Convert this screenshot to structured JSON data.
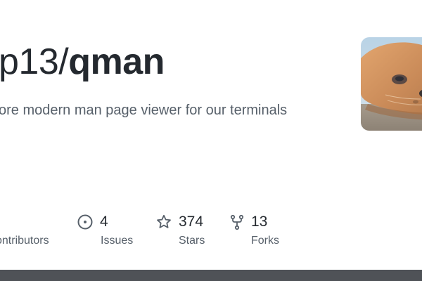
{
  "repo": {
    "owner": "p13",
    "separator": "/",
    "name": "qman",
    "description": "ore modern man page viewer for our terminals"
  },
  "stats": {
    "contributors": {
      "label": "ontributors"
    },
    "issues": {
      "value": "4",
      "label": "Issues",
      "icon": "issue-open-icon"
    },
    "stars": {
      "value": "374",
      "label": "Stars",
      "icon": "star-icon"
    },
    "forks": {
      "value": "13",
      "label": "Forks",
      "icon": "repo-forked-icon"
    }
  },
  "colors": {
    "title": "#24292f",
    "muted": "#57606a",
    "bottom_bar": "#4f5257"
  }
}
